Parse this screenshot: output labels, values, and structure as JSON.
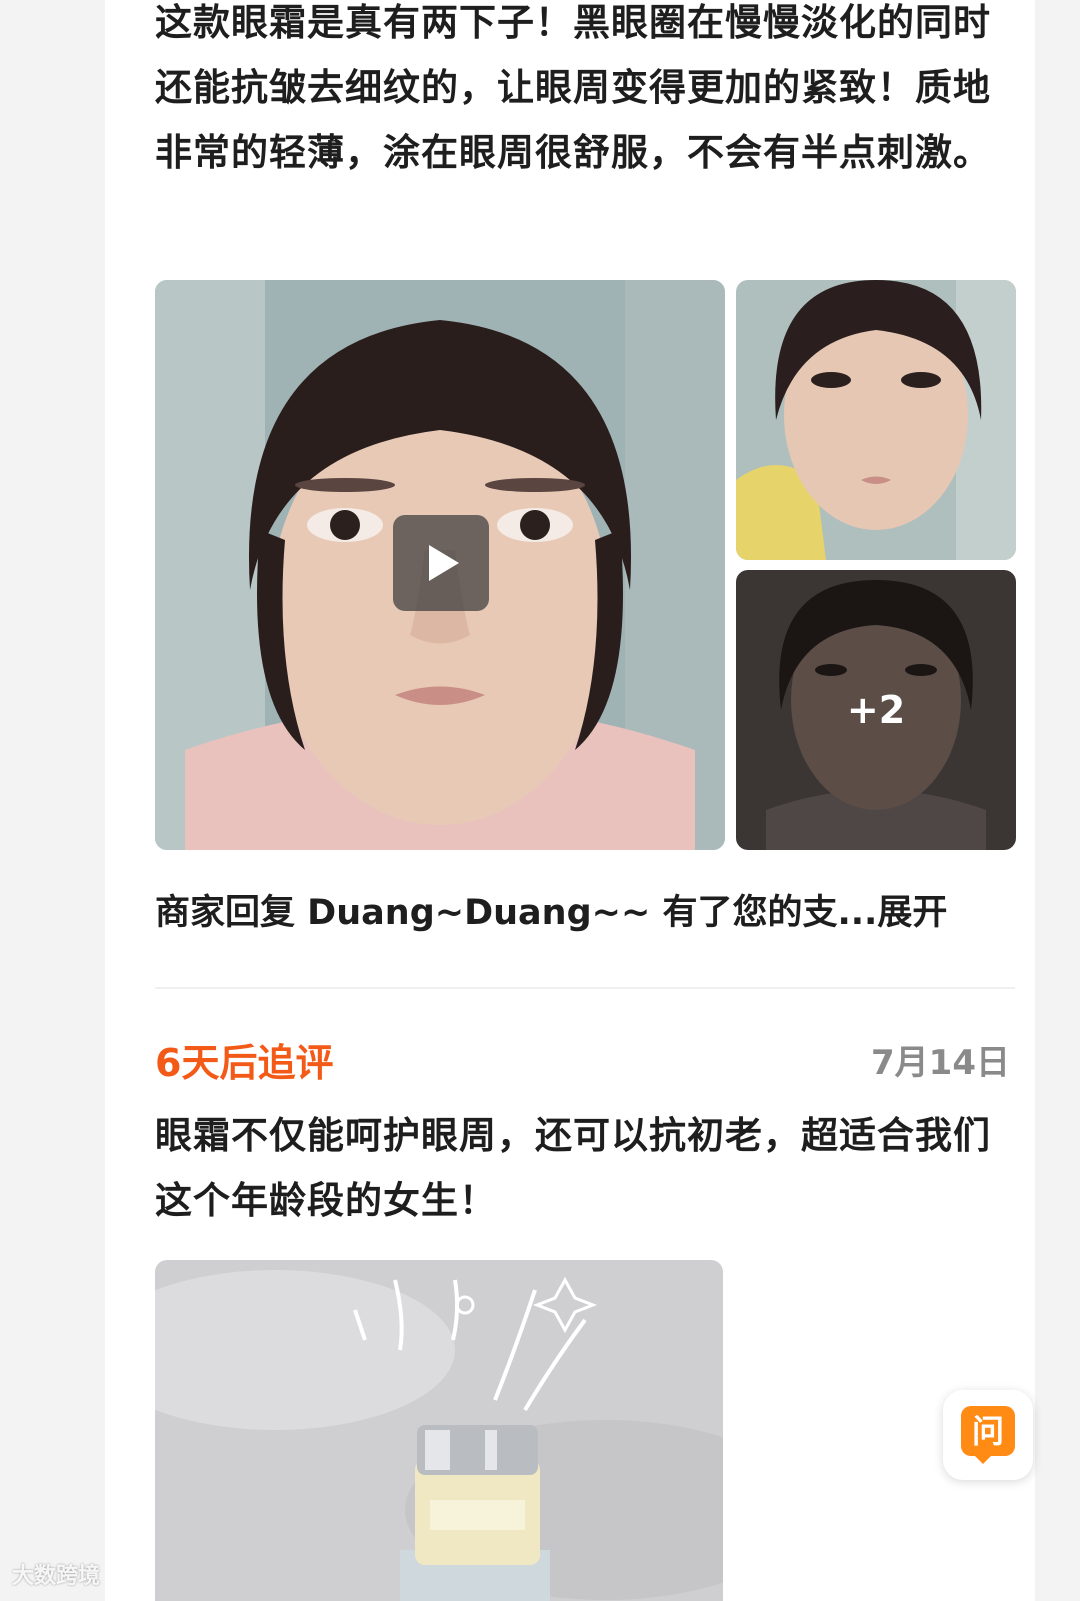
{
  "review_first": {
    "text": "这款眼霜是真有两下子！黑眼圈在慢慢淡化的同时还能抗皱去细纹的，让眼周变得更加的紧致！质地非常的轻薄，涂在眼周很舒服，不会有半点刺激。"
  },
  "media_gallery": {
    "more_count": "+2",
    "play_icon": "play-icon"
  },
  "merchant_reply": {
    "text": "商家回复 Duang~Duang~~ 有了您的支...",
    "expand_label": "展开"
  },
  "followup": {
    "label": "6天后追评",
    "date": "7月14日",
    "text": "眼霜不仅能呵护眼周，还可以抗初老，超适合我们这个年龄段的女生！"
  },
  "ask_button": {
    "label": "问"
  },
  "watermark": {
    "text": "大数跨境"
  },
  "colors": {
    "accent_orange": "#f35a18",
    "fab_orange": "#ff8a14",
    "text_dark": "#1e1e1e",
    "text_gray": "#8a8a8a"
  }
}
